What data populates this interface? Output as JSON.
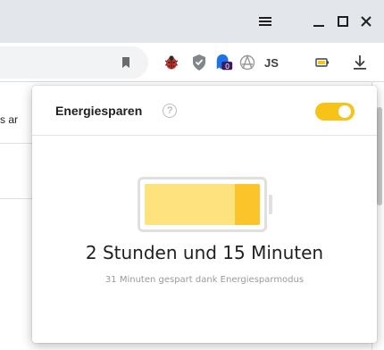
{
  "window": {
    "menu_icon": "menu-icon",
    "minimize_icon": "minimize-icon",
    "maximize_icon": "maximize-icon",
    "close_icon": "close-icon"
  },
  "toolbar": {
    "bookmark_icon": "bookmark-icon",
    "extensions": [
      {
        "name": "ladybug-extension-icon"
      },
      {
        "name": "shield-extension-icon"
      },
      {
        "name": "ghostery-extension-icon",
        "badge": "0"
      },
      {
        "name": "anarchy-extension-icon"
      },
      {
        "name": "js-extension-icon",
        "label": "JS"
      },
      {
        "name": "battery-extension-icon"
      }
    ],
    "download_icon": "download-icon"
  },
  "page": {
    "fragment_text": "s ar"
  },
  "popup": {
    "title": "Energiesparen",
    "help_symbol": "?",
    "toggle_on": true,
    "battery_level": 1.0,
    "saved_portion": 0.22,
    "time_remaining": "2 Stunden und 15 Minuten",
    "saved_text": "31 Minuten gespart dank Energiesparmodus"
  },
  "colors": {
    "accent": "#f8c319",
    "battery_light": "#fde27e",
    "battery_strong": "#fbc42a"
  }
}
